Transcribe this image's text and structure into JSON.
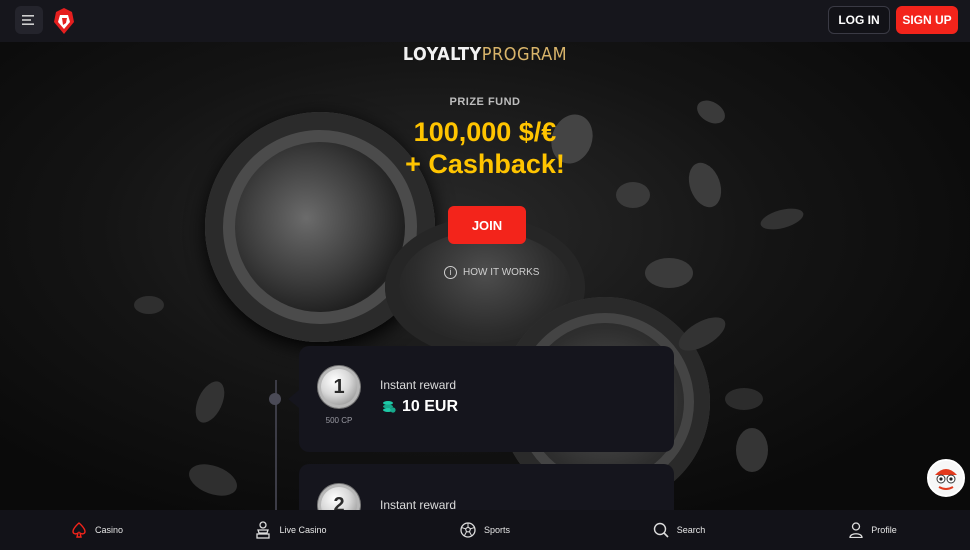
{
  "header": {
    "login_label": "LOG IN",
    "signup_label": "SIGN UP"
  },
  "hero": {
    "title_word1": "LOYALTY",
    "title_word2": "PROGRAM",
    "prize_label": "PRIZE FUND",
    "prize_amount": "100,000 $/€",
    "prize_cashback": "+ Cashback!",
    "join_label": "JOIN",
    "how_it_works_label": "HOW IT WORKS"
  },
  "rewards": [
    {
      "level": "1",
      "points": "500 CP",
      "label": "Instant reward",
      "value": "10 EUR"
    },
    {
      "level": "2",
      "label": "Instant reward"
    }
  ],
  "bottom_nav": [
    {
      "label": "Casino",
      "icon": "spade-icon"
    },
    {
      "label": "Live Casino",
      "icon": "dealer-icon"
    },
    {
      "label": "Sports",
      "icon": "soccer-ball-icon"
    },
    {
      "label": "Search",
      "icon": "search-icon"
    },
    {
      "label": "Profile",
      "icon": "user-icon"
    }
  ],
  "colors": {
    "accent_red": "#f3241b",
    "prize_yellow": "#ffc400",
    "program_gold": "#d8b46a",
    "coin_teal": "#1ec9a7"
  }
}
